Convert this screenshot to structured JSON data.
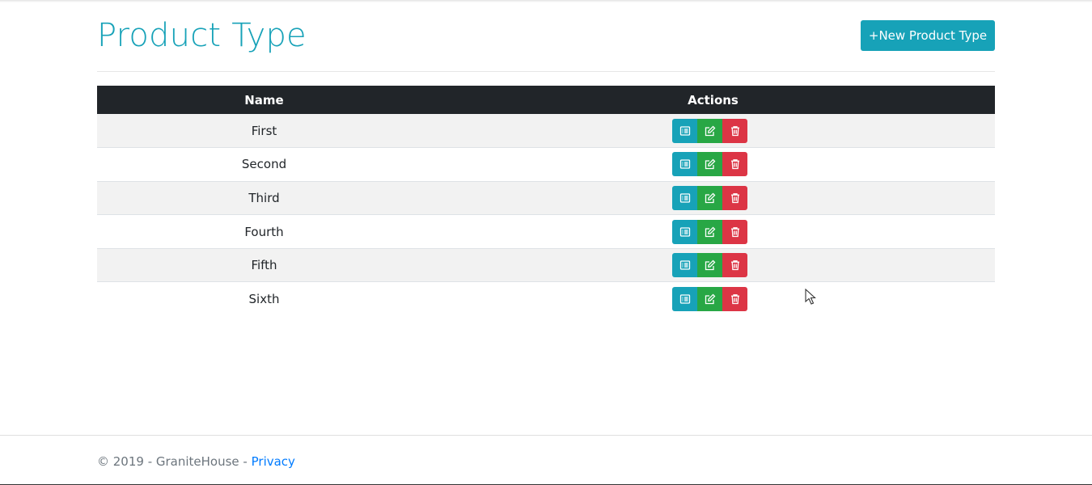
{
  "header": {
    "title": "Product Type",
    "new_button_label": "+New Product Type"
  },
  "table": {
    "columns": [
      "Name",
      "Actions"
    ],
    "rows": [
      {
        "name": "First"
      },
      {
        "name": "Second"
      },
      {
        "name": "Third"
      },
      {
        "name": "Fourth"
      },
      {
        "name": "Fifth"
      },
      {
        "name": "Sixth"
      }
    ]
  },
  "footer": {
    "copyright": "© 2019 - GraniteHouse - ",
    "privacy_label": "Privacy"
  },
  "icons": {
    "details": "list-icon",
    "edit": "edit-icon",
    "delete": "trash-icon"
  },
  "colors": {
    "accent": "#17a2b8",
    "success": "#28a745",
    "danger": "#dc3545",
    "table_header": "#212529",
    "link": "#007bff"
  }
}
